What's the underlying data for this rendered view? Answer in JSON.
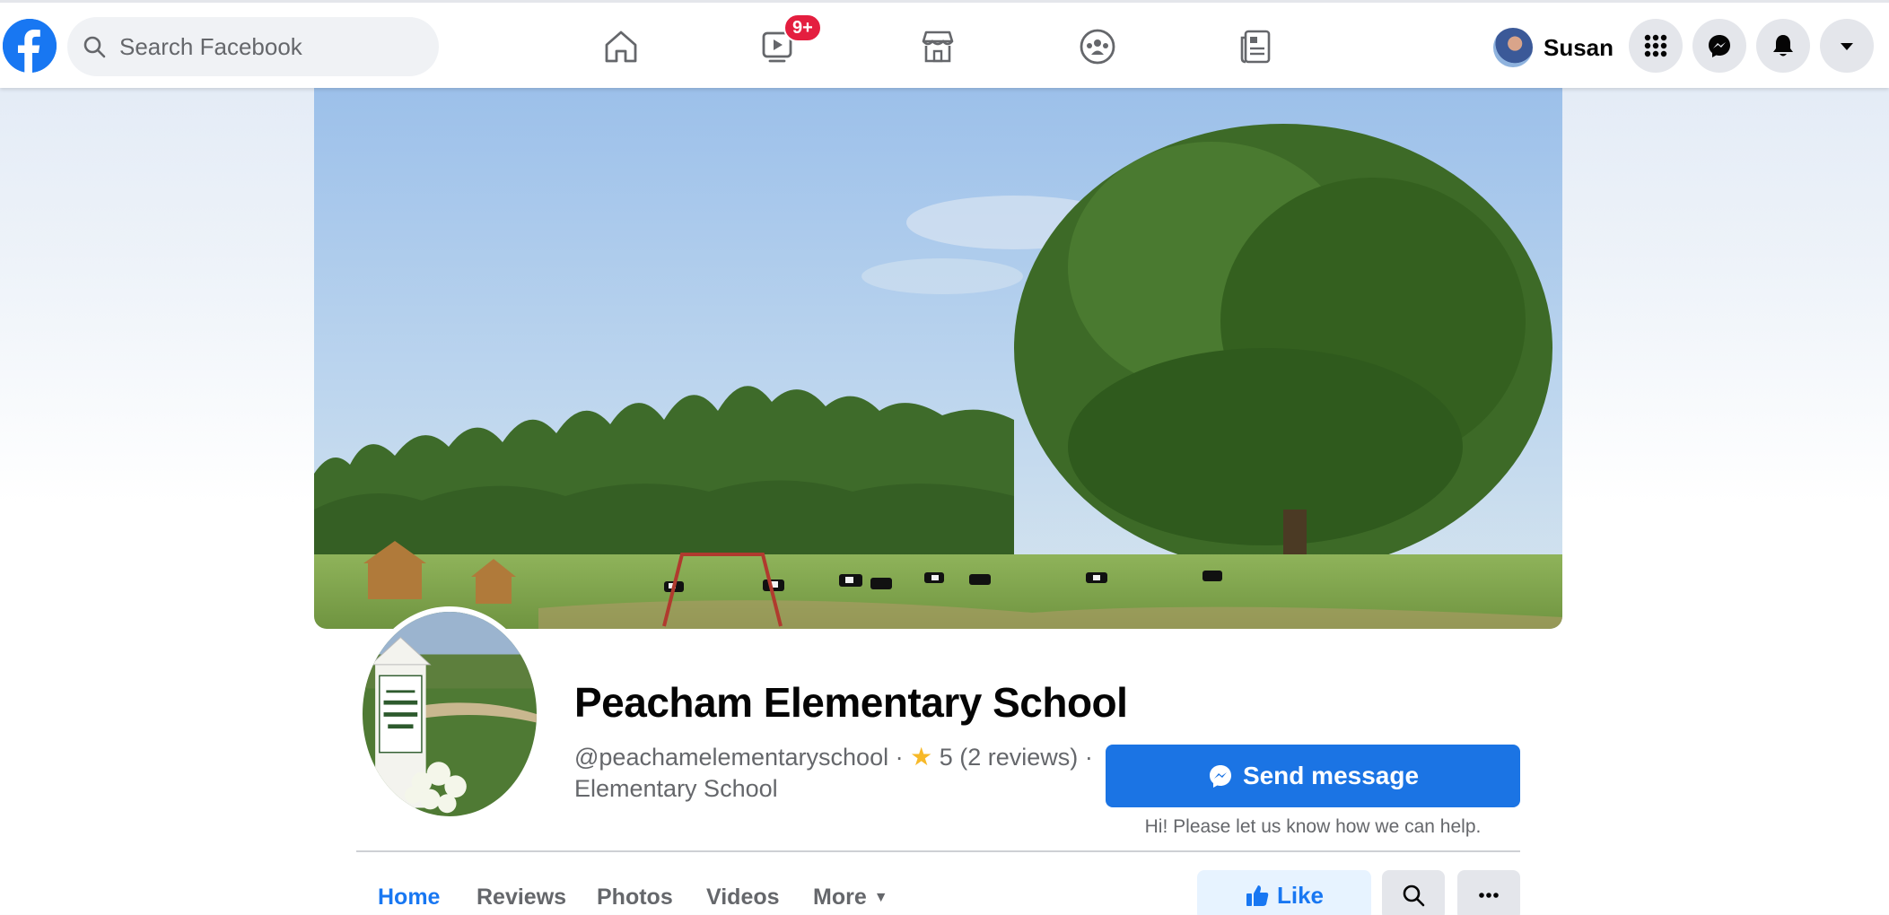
{
  "topbar": {
    "search_placeholder": "Search Facebook",
    "watch_badge": "9+",
    "user_name": "Susan",
    "brand_color": "#1877f2",
    "nav_icons": [
      "home-icon",
      "watch-icon",
      "marketplace-icon",
      "groups-icon",
      "news-feed-icon"
    ],
    "right_icons": [
      "menu-grid-icon",
      "messenger-icon",
      "notifications-icon",
      "account-caret-icon"
    ]
  },
  "page": {
    "title": "Peacham Elementary School",
    "handle": "@peachamelementaryschool",
    "separator": "·",
    "rating": "5 (2 reviews)",
    "category": "Elementary School",
    "star_color": "#f7b928"
  },
  "actions": {
    "send_message": "Send message",
    "help_text": "Hi! Please let us know how we can help.",
    "like": "Like"
  },
  "tabs": [
    {
      "label": "Home",
      "active": true
    },
    {
      "label": "Reviews",
      "active": false
    },
    {
      "label": "Photos",
      "active": false
    },
    {
      "label": "Videos",
      "active": false
    },
    {
      "label": "More",
      "active": false
    }
  ]
}
